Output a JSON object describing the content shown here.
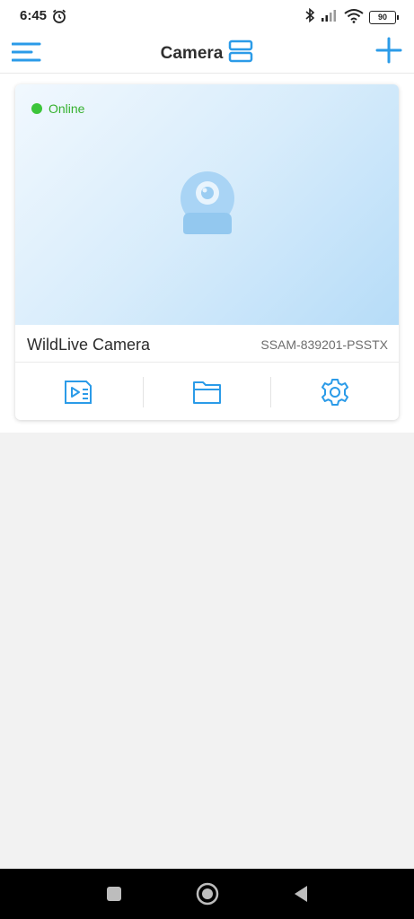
{
  "status_bar": {
    "time": "6:45",
    "battery": "90",
    "icons": [
      "alarm-icon",
      "bluetooth-icon",
      "signal-icon",
      "wifi-icon",
      "battery-icon"
    ]
  },
  "header": {
    "title": "Camera",
    "icons": [
      "menu-icon",
      "layout-toggle-icon",
      "add-icon"
    ],
    "accent": "#2b9be8"
  },
  "camera_card": {
    "status": "Online",
    "status_color": "#3cc53a",
    "name": "WildLive Camera",
    "serial": "SSAM-839201-PSSTX",
    "actions": [
      "playback-icon",
      "folder-icon",
      "settings-icon"
    ]
  },
  "nav_bar": {
    "buttons": [
      "recent-apps-icon",
      "home-icon",
      "back-icon"
    ]
  }
}
